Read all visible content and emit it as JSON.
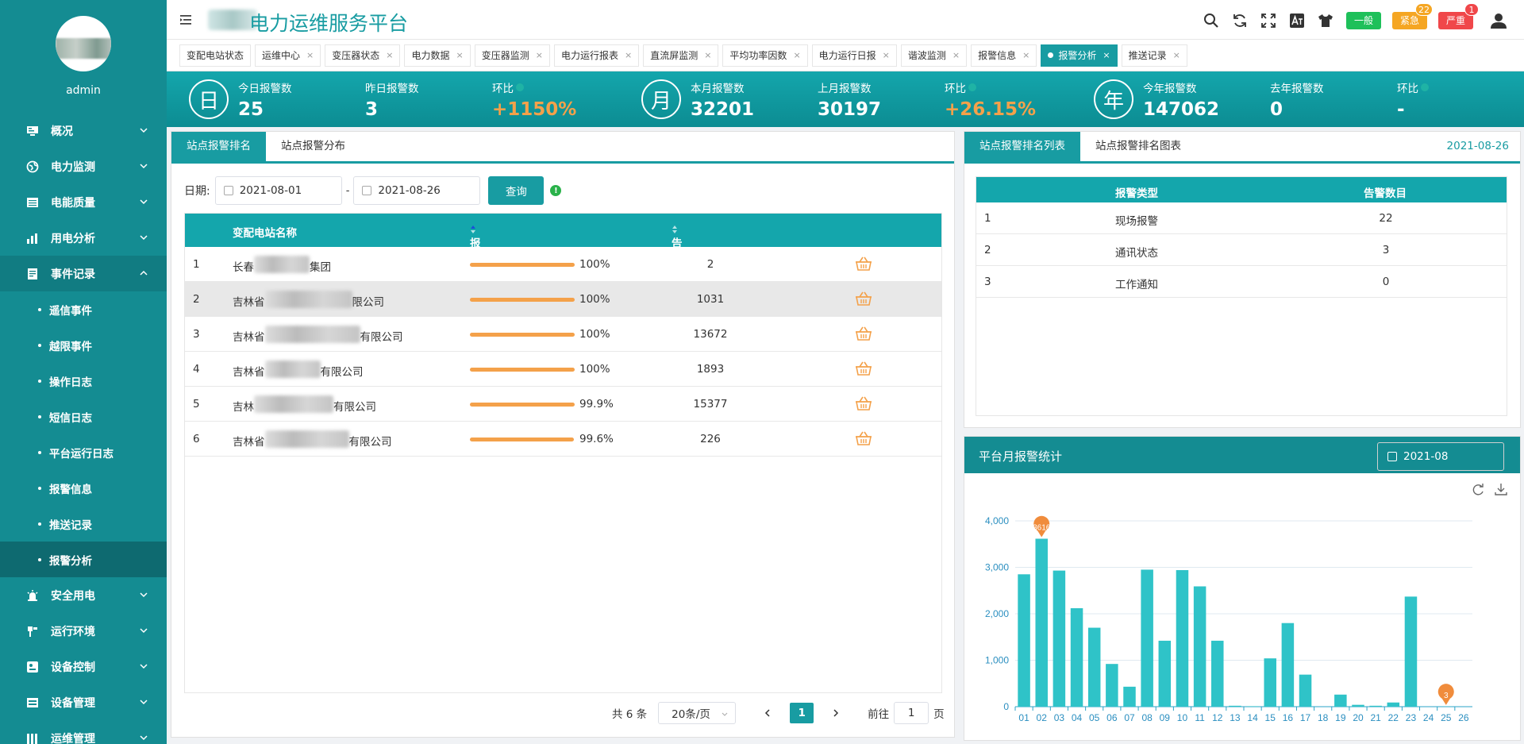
{
  "sidebar": {
    "username": "admin",
    "menu": [
      {
        "label": "概况",
        "icon": "monitor-icon",
        "expanded": false
      },
      {
        "label": "电力监测",
        "icon": "globe-icon",
        "expanded": false
      },
      {
        "label": "电能质量",
        "icon": "table-icon",
        "expanded": false
      },
      {
        "label": "用电分析",
        "icon": "bar-chart-icon",
        "expanded": false
      },
      {
        "label": "事件记录",
        "icon": "document-icon",
        "expanded": true
      }
    ],
    "submenu": [
      "遥信事件",
      "越限事件",
      "操作日志",
      "短信日志",
      "平台运行日志",
      "报警信息",
      "推送记录",
      "报警分析"
    ],
    "active_sub": "报警分析",
    "menu2": [
      {
        "label": "安全用电",
        "icon": "alarm-light-icon"
      },
      {
        "label": "运行环境",
        "icon": "environment-icon"
      },
      {
        "label": "设备控制",
        "icon": "control-icon"
      },
      {
        "label": "设备管理",
        "icon": "device-icon"
      },
      {
        "label": "运维管理",
        "icon": "ops-icon"
      }
    ]
  },
  "header": {
    "title": "电力运维服务平台",
    "levels": [
      {
        "label": "一般",
        "count": "",
        "color": "#1ec05a"
      },
      {
        "label": "紧急",
        "count": "22",
        "color": "#f5a623"
      },
      {
        "label": "严重",
        "count": "1",
        "color": "#f0474a"
      }
    ]
  },
  "tabs": [
    {
      "label": "变配电站状态",
      "closable": false
    },
    {
      "label": "运维中心",
      "closable": true
    },
    {
      "label": "变压器状态",
      "closable": true
    },
    {
      "label": "电力数据",
      "closable": true
    },
    {
      "label": "变压器监测",
      "closable": true
    },
    {
      "label": "电力运行报表",
      "closable": true
    },
    {
      "label": "直流屏监测",
      "closable": true
    },
    {
      "label": "平均功率因数",
      "closable": true
    },
    {
      "label": "电力运行日报",
      "closable": true
    },
    {
      "label": "谐波监测",
      "closable": true
    },
    {
      "label": "报警信息",
      "closable": true
    },
    {
      "label": "报警分析",
      "closable": true,
      "active": true
    },
    {
      "label": "推送记录",
      "closable": true
    }
  ],
  "stats": {
    "day": {
      "glyph": "日",
      "today_label": "今日报警数",
      "today": "25",
      "yest_label": "昨日报警数",
      "yest": "3",
      "ratio_label": "环比",
      "ratio": "+1150%"
    },
    "month": {
      "glyph": "月",
      "this_label": "本月报警数",
      "this": "32201",
      "last_label": "上月报警数",
      "last": "30197",
      "ratio_label": "环比",
      "ratio": "+26.15%"
    },
    "year": {
      "glyph": "年",
      "this_label": "今年报警数",
      "this": "147062",
      "last_label": "去年报警数",
      "last": "0",
      "ratio_label": "环比",
      "ratio": "-"
    }
  },
  "left_panel": {
    "tabs": [
      "站点报警排名",
      "站点报警分布"
    ],
    "date_label": "日期:",
    "date_from": "2021-08-01",
    "date_sep": "-",
    "date_to": "2021-08-26",
    "query_label": "查询",
    "columns": [
      "变配电站名称",
      "报警处理率",
      "告警数目"
    ],
    "rows": [
      {
        "idx": "1",
        "name_start": "长春",
        "name_end": "集团",
        "rate_text": "100%",
        "rate": 1.0,
        "count": "2"
      },
      {
        "idx": "2",
        "name_start": "吉林省",
        "name_end": "限公司",
        "rate_text": "100%",
        "rate": 1.0,
        "count": "1031"
      },
      {
        "idx": "3",
        "name_start": "吉林省",
        "name_end": "有限公司",
        "rate_text": "100%",
        "rate": 1.0,
        "count": "13672"
      },
      {
        "idx": "4",
        "name_start": "吉林省",
        "name_end": "有限公司",
        "rate_text": "100%",
        "rate": 1.0,
        "count": "1893"
      },
      {
        "idx": "5",
        "name_start": "吉林",
        "name_end": "有限公司",
        "rate_text": "99.9%",
        "rate": 0.999,
        "count": "15377"
      },
      {
        "idx": "6",
        "name_start": "吉林省",
        "name_end": "有限公司",
        "rate_text": "99.6%",
        "rate": 0.996,
        "count": "226"
      }
    ],
    "pager": {
      "total": "共 6 条",
      "page_size": "20条/页",
      "current": "1",
      "goto": "前往",
      "goto_val": "1",
      "page_unit": "页"
    }
  },
  "right_panel": {
    "tabs": [
      "站点报警排名列表",
      "站点报警排名图表"
    ],
    "date": "2021-08-26",
    "columns": [
      "报警类型",
      "告警数目"
    ],
    "rows": [
      {
        "idx": "1",
        "type": "现场报警",
        "count": "22"
      },
      {
        "idx": "2",
        "type": "通讯状态",
        "count": "3"
      },
      {
        "idx": "3",
        "type": "工作通知",
        "count": "0"
      }
    ]
  },
  "chart_panel": {
    "title": "平台月报警统计",
    "month": "2021-08"
  },
  "chart_data": {
    "type": "bar",
    "categories": [
      "01",
      "02",
      "03",
      "04",
      "05",
      "06",
      "07",
      "08",
      "09",
      "10",
      "11",
      "12",
      "13",
      "14",
      "15",
      "16",
      "17",
      "18",
      "19",
      "20",
      "21",
      "22",
      "23",
      "24",
      "25",
      "26"
    ],
    "values": [
      2850,
      3616,
      2930,
      2120,
      1700,
      920,
      430,
      2950,
      1420,
      2940,
      2590,
      1420,
      20,
      10,
      1040,
      1800,
      690,
      0,
      260,
      40,
      20,
      90,
      2370,
      0,
      3,
      0
    ],
    "y_ticks": [
      "0",
      "1,000",
      "2,000",
      "3,000",
      "4,000"
    ],
    "ylim": [
      0,
      4000
    ],
    "markers": [
      {
        "category": "02",
        "label": "3616"
      },
      {
        "category": "25",
        "label": "3"
      }
    ],
    "bar_color": "#2fc3c8",
    "marker_color": "#f08c3c"
  }
}
